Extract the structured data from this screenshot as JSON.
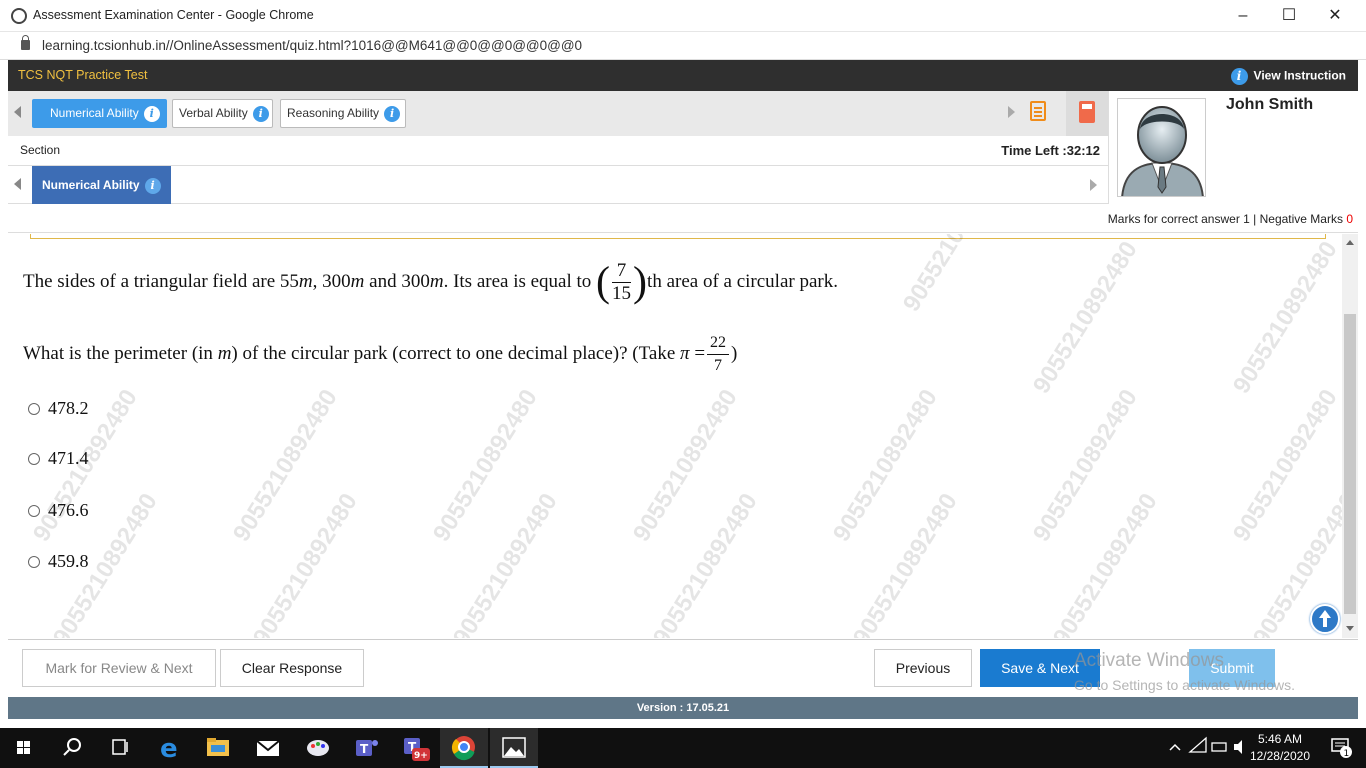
{
  "window": {
    "title": "Assessment Examination Center - Google Chrome",
    "url": "learning.tcsionhub.in//OnlineAssessment/quiz.html?1016@@M641@@0@@0@@0@@0",
    "minimize": "–",
    "maximize": "☐",
    "close": "✕"
  },
  "header": {
    "brand": "TCS NQT Practice Test",
    "view_instruction": "View Instruction"
  },
  "section_tabs": [
    {
      "label": "Numerical Ability",
      "active": true
    },
    {
      "label": "Verbal Ability",
      "active": false
    },
    {
      "label": "Reasoning Ability",
      "active": false
    }
  ],
  "info_glyph": "i",
  "section_label": "Section",
  "time_left": "Time Left :32:12",
  "subsection_tab": "Numerical Ability",
  "candidate": {
    "name": "John Smith"
  },
  "marks": {
    "text": "Marks for correct answer 1 | Negative Marks ",
    "negative": "0"
  },
  "question": {
    "line1_a": "The sides of a triangular  field are ",
    "s1": "55",
    "unit": "m",
    "comma": ", ",
    "s2": "300",
    "and": " and ",
    "s3": "300",
    "line1_b": ". Its area is equal to ",
    "frac_num": "7",
    "frac_den": "15",
    "line1_c": "th area of a circular park.",
    "line2_a": "What is the perimeter (in ",
    "line2_unit": "m",
    "line2_b": ") of the circular park (correct to one decimal place)? (Take ",
    "pi": "π",
    "eq": " =",
    "pi_num": "22",
    "pi_den": "7",
    "line2_c": ")"
  },
  "options": [
    "478.2",
    "471.4",
    "476.6",
    "459.8"
  ],
  "watermark": "9055210892480",
  "buttons": {
    "mark_review": "Mark for Review & Next",
    "clear": "Clear Response",
    "previous": "Previous",
    "save_next": "Save & Next",
    "submit": "Submit"
  },
  "activate_windows": {
    "title": "Activate Windows",
    "subtitle": "Go to Settings to activate Windows."
  },
  "version": "Version : 17.05.21",
  "taskbar": {
    "time": "5:46 AM",
    "date": "12/28/2020",
    "teams_badge": "9+",
    "notif_count": "1",
    "icons": [
      "windows-start-icon",
      "search-icon",
      "task-view-icon",
      "edge-icon",
      "file-explorer-icon",
      "mail-icon",
      "paint-icon",
      "teams-icon",
      "teams-work-icon",
      "chrome-icon",
      "photos-icon"
    ]
  },
  "colors": {
    "accent": "#3d9be9",
    "primary_button": "#1a7bd0",
    "topbar": "#2f2f2f",
    "brand_text": "#f0c040",
    "version_bar": "#5f7687"
  }
}
